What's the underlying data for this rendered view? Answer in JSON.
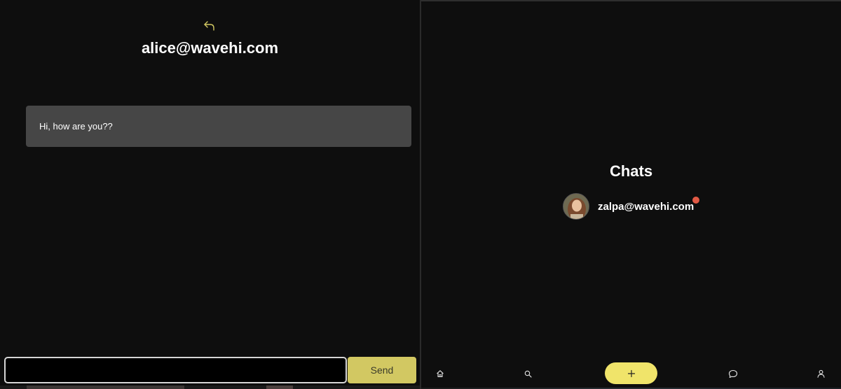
{
  "chat_view": {
    "title": "alice@wavehi.com",
    "messages": [
      {
        "text": "Hi, how are you??"
      }
    ],
    "composer": {
      "value": "",
      "placeholder": "",
      "send_label": "Send"
    }
  },
  "chats_view": {
    "heading": "Chats",
    "chats": [
      {
        "name": "zalpa@wavehi.com",
        "avatar_icon": "avatar-photo",
        "unread": true
      }
    ],
    "nav": {
      "items": [
        "home-icon",
        "search-icon",
        "plus-icon",
        "chat-bubble-icon",
        "user-icon"
      ]
    }
  },
  "colors": {
    "background": "#0e0e0e",
    "bubble": "#464646",
    "send_button": "#d2c862",
    "add_button": "#f0e46a",
    "unread_dot": "#e25a45",
    "back_icon": "#d2c862"
  }
}
